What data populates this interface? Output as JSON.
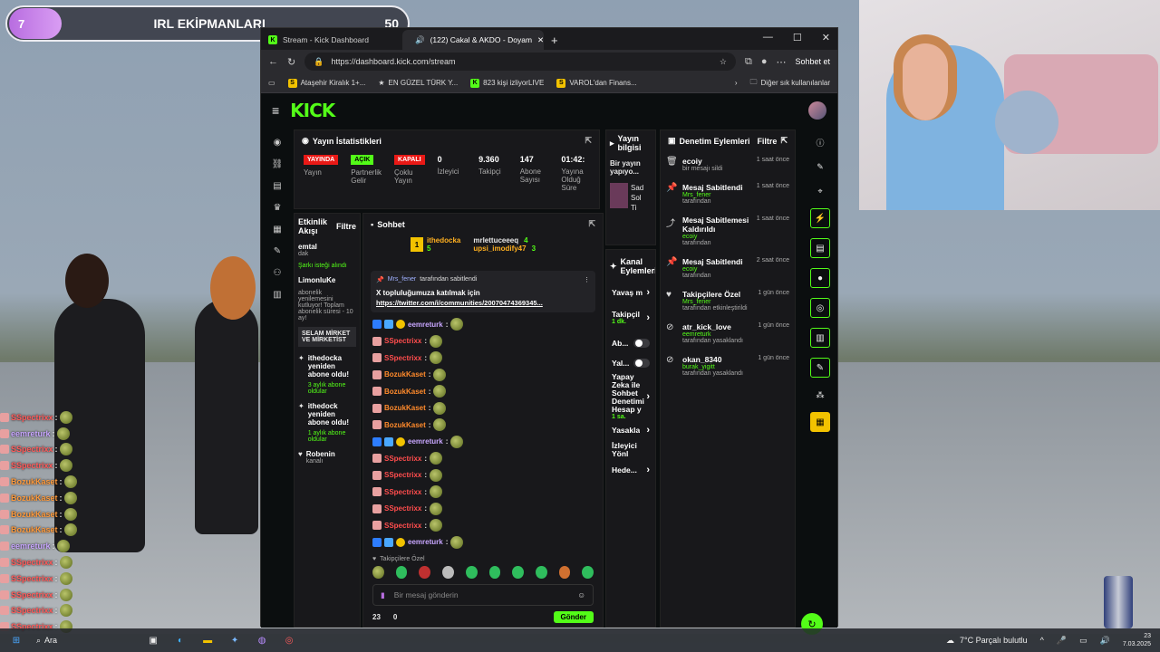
{
  "overlay": {
    "goal_current": "7",
    "goal_title": "IRL EKİPMANLARI",
    "goal_target": "50"
  },
  "browser": {
    "tabs": [
      {
        "label": "Stream - Kick Dashboard",
        "active": false
      },
      {
        "label": "(122) Cakal & AKDO - Doyam",
        "active": true
      }
    ],
    "new_tab": "+",
    "window_controls": [
      "—",
      "☐",
      "✕"
    ],
    "url": "https://dashboard.kick.com/stream",
    "copilot_label": "Sohbet et",
    "bookmarks": [
      {
        "icon": "S",
        "label": "Ataşehir Kiralık 1+..."
      },
      {
        "icon": "★",
        "label": "EN GÜZEL TÜRK Y..."
      },
      {
        "icon": "K",
        "label": "823 kişi izliyorLIVE"
      },
      {
        "icon": "S",
        "label": "VAROL'dan Finans..."
      }
    ],
    "other_bookmarks": "Diğer sık kullanılanlar"
  },
  "kick": {
    "logo": "KICK",
    "stats": {
      "title": "Yayın İstatistikleri",
      "items": [
        {
          "badge": "YAYINDA",
          "label": "Yayın"
        },
        {
          "badge": "AÇIK",
          "label": "Partnerlik Gelir"
        },
        {
          "badge": "KAPALI",
          "label": "Çoklu Yayın"
        },
        {
          "value": "0",
          "label": "İzleyici"
        },
        {
          "value": "9.360",
          "label": "Takipçi"
        },
        {
          "value": "147",
          "label": "Abone Sayısı"
        },
        {
          "value": "01:42:",
          "label": "Yayına Olduğ Süre"
        }
      ]
    },
    "stream_info": {
      "title": "Yayın bilgisi",
      "text": "Bir yayın yapıyo...",
      "card_a": "Sad",
      "card_b": "Sol",
      "card_c": "Ti"
    },
    "activity": {
      "title": "Etkinlik Akışı",
      "filter": "Filtre",
      "items": [
        {
          "name": "emtal",
          "sub": "dak",
          "extra": "önc",
          "note": "Şarkı isteği alındı"
        },
        {
          "name": "LimonluKe",
          "body": "abonelik yenilemesini kutluyor! Toplam abonelik süresi - 10 ay!",
          "msg": "SELAM MİRKET VE MİRKETİST"
        },
        {
          "name": "ithedocka yeniden abone oldu!",
          "sub": "3 aylık abone oldular"
        },
        {
          "name": "ithedock yeniden abone oldu!",
          "sub": "1 aylık abone oldular"
        },
        {
          "name": "Robenin",
          "sub": "kanalı"
        }
      ]
    },
    "chat": {
      "title": "Sohbet",
      "gifters": [
        {
          "rank": "1",
          "name": "ithedocka",
          "count": "5"
        },
        {
          "name": "mrlettuceeeq",
          "count": "4"
        },
        {
          "name": "upsi_imodify47",
          "count": "3"
        }
      ],
      "pinned": {
        "by": "Mrs_fener",
        "by_text": "tarafından sabitlendi",
        "text": "X topluluğumuza katılmak için",
        "link": "https://twitter.com/i/communities/20070474369345..."
      },
      "messages": [
        {
          "user": "eemreturk",
          "color": "#c8a6ff"
        },
        {
          "user": "SSpectrixx",
          "color": "#ff4d4d"
        },
        {
          "user": "SSpectrixx",
          "color": "#ff4d4d"
        },
        {
          "user": "BozukKaset",
          "color": "#ff8a2b"
        },
        {
          "user": "BozukKaset",
          "color": "#ff8a2b"
        },
        {
          "user": "BozukKaset",
          "color": "#ff8a2b"
        },
        {
          "user": "BozukKaset",
          "color": "#ff8a2b"
        },
        {
          "user": "eemreturk",
          "color": "#c8a6ff"
        },
        {
          "user": "SSpectrixx",
          "color": "#ff4d4d"
        },
        {
          "user": "SSpectrixx",
          "color": "#ff4d4d"
        },
        {
          "user": "SSpectrixx",
          "color": "#ff4d4d"
        },
        {
          "user": "SSpectrixx",
          "color": "#ff4d4d"
        },
        {
          "user": "SSpectrixx",
          "color": "#ff4d4d"
        },
        {
          "user": "eemreturk",
          "color": "#c8a6ff"
        }
      ],
      "followers_only": "Takipçilere Özel",
      "input_placeholder": "Bir mesaj gönderin",
      "send_label": "Gönder",
      "count_a": "23",
      "count_b": "0"
    },
    "channel_actions": {
      "title": "Kanal Eylemleri",
      "items": [
        {
          "label": "Yavaş m",
          "type": "chevron"
        },
        {
          "label": "Takipçil",
          "sub": "1 dk.",
          "type": "chevron"
        },
        {
          "label": "Ab...",
          "type": "toggle"
        },
        {
          "label": "Yal...",
          "type": "toggle"
        },
        {
          "label": "Yapay Zeka ile Sohbet Denetimi Hesap y",
          "sub": "1 sa.",
          "type": "chevron"
        },
        {
          "label": "Yasakla",
          "type": "chevron"
        },
        {
          "label": "İzleyici Yönl",
          "type": "none"
        },
        {
          "label": "Hede...",
          "type": "chevron"
        }
      ]
    },
    "moderation": {
      "title": "Denetim Eylemleri",
      "filter": "Filtre",
      "items": [
        {
          "icon": "trash-icon",
          "name": "ecoiy",
          "sub": "bir mesajı sildi",
          "time": "1 saat önce"
        },
        {
          "icon": "pin-icon",
          "name": "Mesaj Sabitlendi",
          "user": "Mrs_fener",
          "sub": "tarafından",
          "time": "1 saat önce"
        },
        {
          "icon": "unpin-icon",
          "name": "Mesaj Sabitlemesi Kaldırıldı",
          "user": "ecoiy",
          "sub": "tarafından",
          "time": "1 saat önce"
        },
        {
          "icon": "pin-icon",
          "name": "Mesaj Sabitlendi",
          "user": "ecoiy",
          "sub": "tarafından",
          "time": "2 saat önce"
        },
        {
          "icon": "heart-icon",
          "name": "Takipçilere Özel",
          "user": "Mrs_fener",
          "sub": "tarafından etkinleştirildi",
          "time": "1 gün önce"
        },
        {
          "icon": "ban-icon",
          "name": "atr_kick_love",
          "user": "eemreturk",
          "sub": "tarafından yasaklandı",
          "time": "1 gün önce"
        },
        {
          "icon": "ban-icon",
          "name": "okan_8340",
          "user": "burak_yigitt",
          "sub": "tarafından yasaklandı",
          "time": "1 gün önce"
        }
      ]
    }
  },
  "overlay_chat": [
    {
      "user": "SSpectrixx",
      "color": "#ff5a5a"
    },
    {
      "user": "eemreturk",
      "color": "#c8a6ff"
    },
    {
      "user": "SSpectrixx",
      "color": "#ff5a5a"
    },
    {
      "user": "SSpectrixx",
      "color": "#ff5a5a"
    },
    {
      "user": "BozukKaset",
      "color": "#ff9a3b"
    },
    {
      "user": "BozukKaset",
      "color": "#ff9a3b"
    },
    {
      "user": "BozukKaset",
      "color": "#ff9a3b"
    },
    {
      "user": "BozukKaset",
      "color": "#ff9a3b"
    },
    {
      "user": "eemreturk",
      "color": "#c8a6ff"
    },
    {
      "user": "SSpectrixx",
      "color": "#ff5a5a"
    },
    {
      "user": "SSpectrixx",
      "color": "#ff5a5a"
    },
    {
      "user": "SSpectrixx",
      "color": "#ff5a5a"
    },
    {
      "user": "SSpectrixx",
      "color": "#ff5a5a"
    },
    {
      "user": "SSpectrixx",
      "color": "#ff5a5a"
    }
  ],
  "taskbar": {
    "search": "Ara",
    "weather": "7°C Parçalı bulutlu",
    "time": "23",
    "date": "7.03.2025"
  },
  "colors": {
    "kick_green": "#53fc18",
    "live_red": "#e91916",
    "panel": "#18181b"
  }
}
